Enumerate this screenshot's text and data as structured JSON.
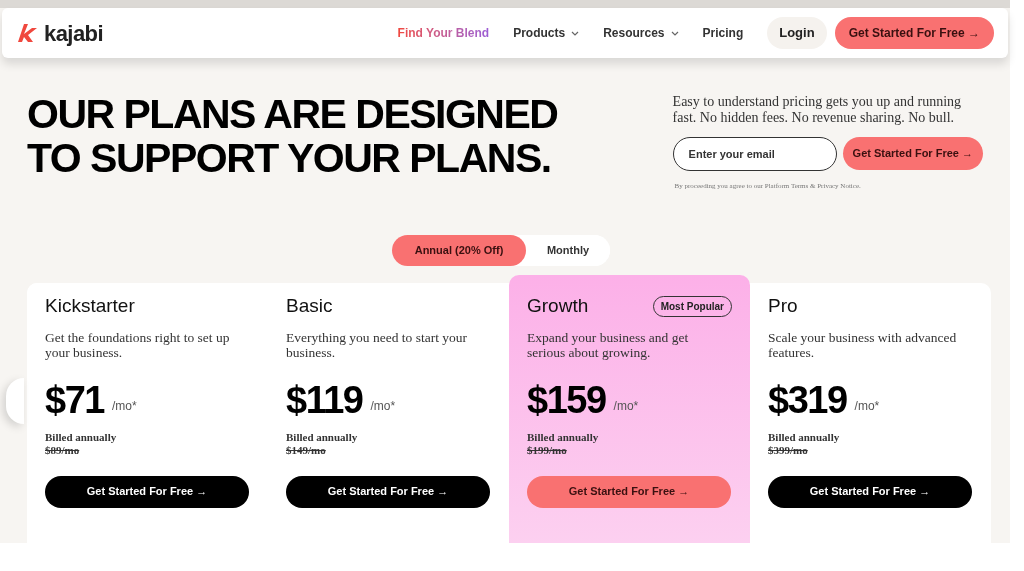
{
  "nav": {
    "logo": "kajabi",
    "links": [
      {
        "label": "Find Your Blend",
        "kind": "highlight"
      },
      {
        "label": "Products",
        "kind": "dropdown"
      },
      {
        "label": "Resources",
        "kind": "dropdown"
      },
      {
        "label": "Pricing",
        "kind": "plain"
      }
    ],
    "login": "Login",
    "cta": "Get Started For Free →"
  },
  "hero": {
    "headline": [
      "OUR PLANS ARE DESIGNED",
      "TO SUPPORT YOUR PLANS."
    ],
    "intro": "Easy to understand pricing gets you up and running fast. No hidden fees. No revenue sharing. No bull.",
    "email": {
      "placeholder": "Enter your email"
    },
    "cta": "Get Started For Free →",
    "legal": "By proceeding you agree to our Platform Terms & Privacy Notice."
  },
  "billing_toggle": [
    {
      "label": "Annual (20% Off)",
      "selected": true
    },
    {
      "label": "Monthly",
      "selected": false
    }
  ],
  "plans": [
    {
      "name": "Kickstarter",
      "description": "Get the foundations right to set up your business.",
      "price": "$71",
      "unit": "/mo*",
      "billing": "Billed annually",
      "old_price": "$89/mo",
      "cta": "Get Started For Free →",
      "featured": false
    },
    {
      "name": "Basic",
      "description": "Everything you need to start your business.",
      "price": "$119",
      "unit": "/mo*",
      "billing": "Billed annually",
      "old_price": "$149/mo",
      "cta": "Get Started For Free →",
      "featured": false
    },
    {
      "name": "Growth",
      "badge": "Most Popular",
      "description": "Expand your business and get serious about growing.",
      "price": "$159",
      "unit": "/mo*",
      "billing": "Billed annually",
      "old_price": "$199/mo",
      "cta": "Get Started For Free →",
      "featured": true
    },
    {
      "name": "Pro",
      "description": "Scale your business with advanced features.",
      "price": "$319",
      "unit": "/mo*",
      "billing": "Billed annually",
      "old_price": "$399/mo",
      "cta": "Get Started For Free →",
      "featured": false
    }
  ]
}
